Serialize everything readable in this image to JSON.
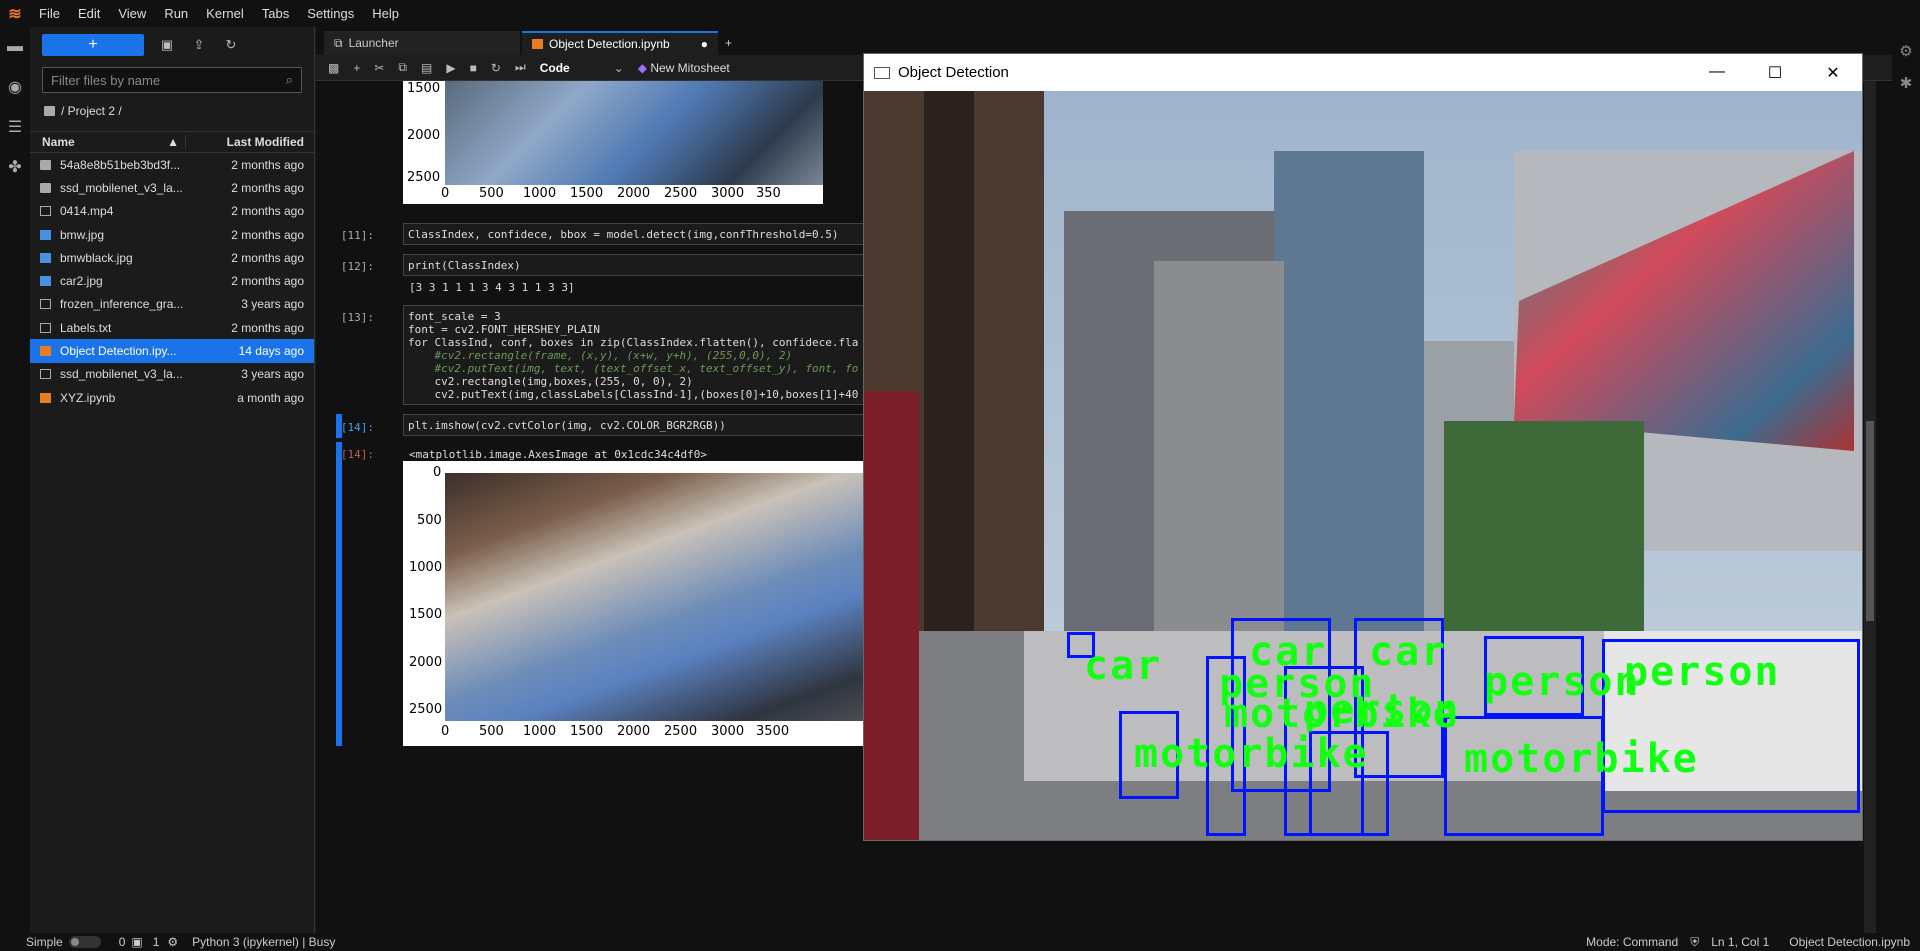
{
  "menubar": {
    "items": [
      "File",
      "Edit",
      "View",
      "Run",
      "Kernel",
      "Tabs",
      "Settings",
      "Help"
    ]
  },
  "filebrowser": {
    "new_label": "+",
    "filter_placeholder": "Filter files by name",
    "breadcrumb": "/ Project 2 /",
    "col_name": "Name",
    "col_modified": "Last Modified",
    "files": [
      {
        "name": "54a8e8b51beb3bd3f...",
        "modified": "2 months ago",
        "type": "folder"
      },
      {
        "name": "ssd_mobilenet_v3_la...",
        "modified": "2 months ago",
        "type": "folder"
      },
      {
        "name": "0414.mp4",
        "modified": "2 months ago",
        "type": "doc"
      },
      {
        "name": "bmw.jpg",
        "modified": "2 months ago",
        "type": "img"
      },
      {
        "name": "bmwblack.jpg",
        "modified": "2 months ago",
        "type": "img"
      },
      {
        "name": "car2.jpg",
        "modified": "2 months ago",
        "type": "img"
      },
      {
        "name": "frozen_inference_gra...",
        "modified": "3 years ago",
        "type": "doc"
      },
      {
        "name": "Labels.txt",
        "modified": "2 months ago",
        "type": "doc"
      },
      {
        "name": "Object Detection.ipy...",
        "modified": "14 days ago",
        "type": "nb",
        "selected": true
      },
      {
        "name": "ssd_mobilenet_v3_la...",
        "modified": "3 years ago",
        "type": "doc"
      },
      {
        "name": "XYZ.ipynb",
        "modified": "a month ago",
        "type": "nb"
      }
    ]
  },
  "tabs": [
    {
      "label": "Launcher",
      "active": false
    },
    {
      "label": "Object Detection.ipynb",
      "active": true
    }
  ],
  "toolbar": {
    "cell_type": "Code",
    "mitosheet": "New Mitosheet"
  },
  "cells": {
    "c11_prompt": "[11]:",
    "c11_code": "ClassIndex, confidece, bbox = model.detect(img,confThreshold=0.5)",
    "c12_prompt": "[12]:",
    "c12_code": "print(ClassIndex)",
    "c12_out": "[3 3 1 1 1 3 4 3 1 1 3 3]",
    "c13_prompt": "[13]:",
    "c13_lines": [
      "font_scale = 3",
      "font = cv2.FONT_HERSHEY_PLAIN",
      "for ClassInd, conf, boxes in zip(ClassIndex.flatten(), confidece.fla",
      "    #cv2.rectangle(frame, (x,y), (x+w, y+h), (255,0,0), 2)",
      "    #cv2.putText(img, text, (text_offset_x, text_offset_y), font, fo",
      "    cv2.rectangle(img,boxes,(255, 0, 0), 2)",
      "    cv2.putText(img,classLabels[ClassInd-1],(boxes[0]+10,boxes[1]+40"
    ],
    "c14_prompt": "[14]:",
    "c14_code": "plt.imshow(cv2.cvtColor(img, cv2.COLOR_BGR2RGB))",
    "c14_out_prompt": "[14]:",
    "c14_out": "<matplotlib.image.AxesImage at 0x1cdc34c4df0>"
  },
  "plot_top": {
    "yticks": [
      "1500",
      "2000",
      "2500"
    ],
    "xticks": [
      "0",
      "500",
      "1000",
      "1500",
      "2000",
      "2500",
      "3000",
      "350"
    ]
  },
  "plot_bottom": {
    "yticks": [
      "0",
      "500",
      "1000",
      "1500",
      "2000",
      "2500"
    ],
    "xticks": [
      "0",
      "500",
      "1000",
      "1500",
      "2000",
      "2500",
      "3000",
      "3500"
    ]
  },
  "cv_window": {
    "title": "Object Detection",
    "labels": [
      "car",
      "car",
      "car",
      "person",
      "person",
      "person",
      "person",
      "motorbike",
      "motorbike",
      "motorbike"
    ]
  },
  "statusbar": {
    "mode_simple": "Simple",
    "count1": "0",
    "count2": "1",
    "kernel": "Python 3 (ipykernel) | Busy",
    "mode": "Mode: Command",
    "position": "Ln 1, Col 1",
    "filename": "Object Detection.ipynb"
  }
}
